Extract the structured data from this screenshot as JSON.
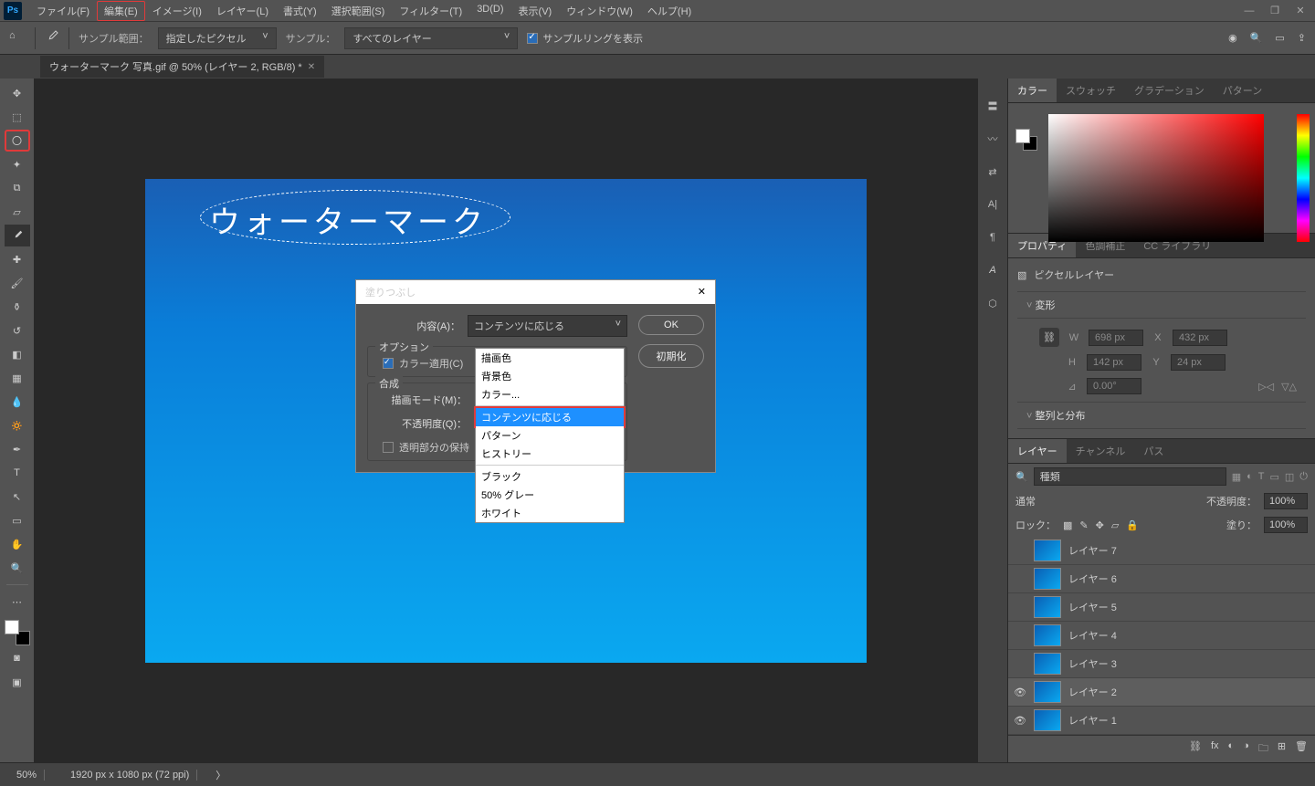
{
  "menu": {
    "items": [
      "ファイル(F)",
      "編集(E)",
      "イメージ(I)",
      "レイヤー(L)",
      "書式(Y)",
      "選択範囲(S)",
      "フィルター(T)",
      "3D(D)",
      "表示(V)",
      "ウィンドウ(W)",
      "ヘルプ(H)"
    ]
  },
  "optbar": {
    "sample_range_label": "サンプル範囲：",
    "sample_range_value": "指定したピクセル",
    "sample_label": "サンプル：",
    "sample_value": "すべてのレイヤー",
    "show_ring": "サンプルリングを表示"
  },
  "tab": {
    "title": "ウォーターマーク 写真.gif @ 50% (レイヤー 2, RGB/8) *"
  },
  "canvas": {
    "watermark_text": "ウォーターマーク"
  },
  "dialog": {
    "title": "塗りつぶし",
    "content_label": "内容(A)：",
    "content_value": "コンテンツに応じる",
    "option_legend": "オプション",
    "color_adapt": "カラー適用(C)",
    "blend_legend": "合成",
    "mode_label": "描画モード(M)：",
    "opacity_label": "不透明度(Q)：",
    "preserve_trans": "透明部分の保持",
    "ok": "OK",
    "reset": "初期化",
    "dropdown": [
      "描画色",
      "背景色",
      "カラー...",
      "コンテンツに応じる",
      "パターン",
      "ヒストリー",
      "ブラック",
      "50% グレー",
      "ホワイト"
    ]
  },
  "panels": {
    "color_tabs": [
      "カラー",
      "スウォッチ",
      "グラデーション",
      "パターン"
    ],
    "prop_tabs": [
      "プロパティ",
      "色調補正",
      "CC ライブラリ"
    ],
    "prop_type": "ピクセルレイヤー",
    "transform_section": "変形",
    "align_section": "整列と分布",
    "W": "698 px",
    "X": "432 px",
    "H": "142 px",
    "Y": "24 px",
    "angle": "0.00°",
    "layer_tabs": [
      "レイヤー",
      "チャンネル",
      "パス"
    ],
    "kind": "種類",
    "blend": "通常",
    "opacity_label": "不透明度：",
    "opacity": "100%",
    "lock_label": "ロック：",
    "fill_label": "塗り：",
    "fill": "100%",
    "layers": [
      {
        "name": "レイヤー 7",
        "vis": false
      },
      {
        "name": "レイヤー 6",
        "vis": false
      },
      {
        "name": "レイヤー 5",
        "vis": false
      },
      {
        "name": "レイヤー 4",
        "vis": false
      },
      {
        "name": "レイヤー 3",
        "vis": false
      },
      {
        "name": "レイヤー 2",
        "vis": true,
        "active": true
      },
      {
        "name": "レイヤー 1",
        "vis": true
      }
    ]
  },
  "status": {
    "zoom": "50%",
    "dims": "1920 px x 1080 px (72 ppi)",
    "arrow": "〉"
  }
}
